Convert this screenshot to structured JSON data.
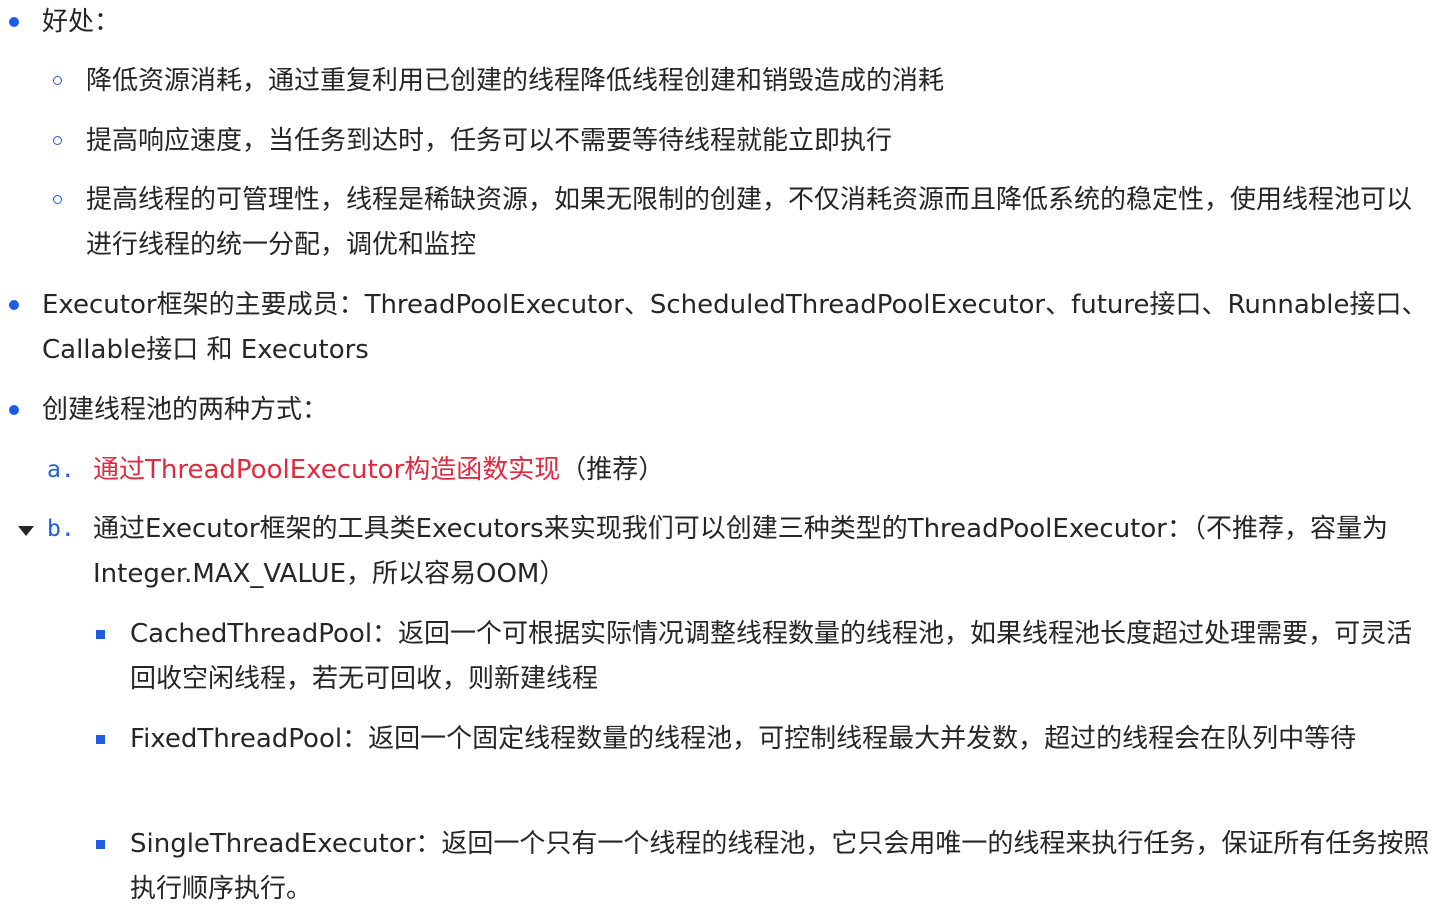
{
  "list": {
    "benefits": {
      "label": "好处：",
      "items": [
        "降低资源消耗，通过重复利用已创建的线程降低线程创建和销毁造成的消耗",
        "提高响应速度，当任务到达时，任务可以不需要等待线程就能立即执行",
        "提高线程的可管理性，线程是稀缺资源，如果无限制的创建，不仅消耗资源而且降低系统的稳定性，使用线程池可以进行线程的统一分配，调优和监控"
      ]
    },
    "members": "Executor框架的主要成员：ThreadPoolExecutor、ScheduledThreadPoolExecutor、future接口、Runnable接口、Callable接口 和 Executors",
    "creation": {
      "label": "创建线程池的两种方式：",
      "option_a": {
        "marker": "a.",
        "highlight": "通过ThreadPoolExecutor构造函数实现",
        "note": "（推荐）"
      },
      "option_b": {
        "marker": "b.",
        "text": "通过Executor框架的工具类Executors来实现我们可以创建三种类型的ThreadPoolExecutor：（不推荐，容量为Integer.MAX_VALUE，所以容易OOM）",
        "items": [
          "CachedThreadPool：返回一个可根据实际情况调整线程数量的线程池，如果线程池长度超过处理需要，可灵活回收空闲线程，若无可回收，则新建线程",
          "FixedThreadPool：返回一个固定线程数量的线程池，可控制线程最大并发数，超过的线程会在队列中等待",
          "SingleThreadExecutor：返回一个只有一个线程的线程池，它只会用唯一的线程来执行任务，保证所有任务按照执行顺序执行。"
        ]
      }
    }
  },
  "colors": {
    "bullet": "#1f5ce6",
    "text": "#262626",
    "highlight": "#df2a3f"
  }
}
